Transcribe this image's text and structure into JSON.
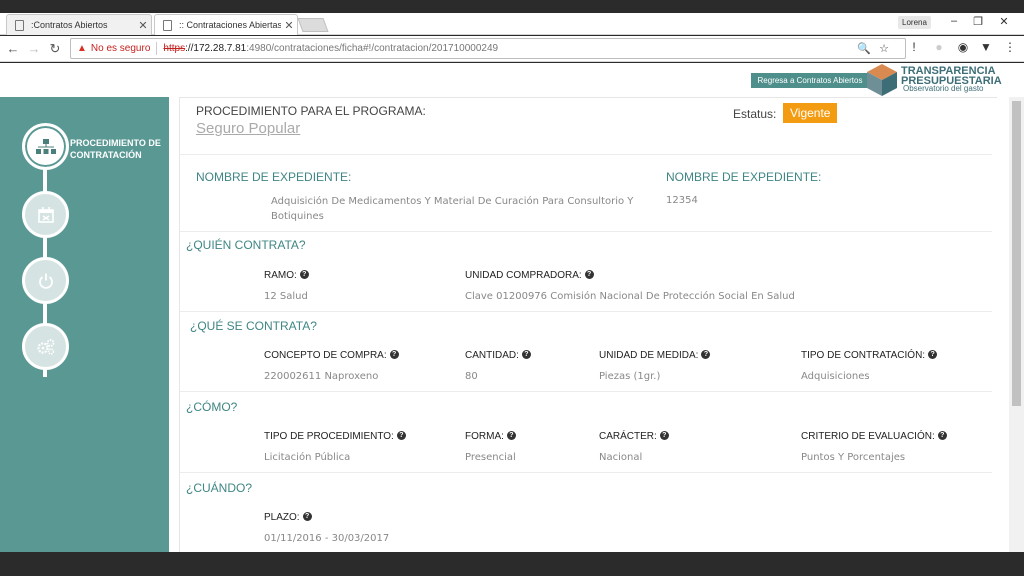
{
  "browser": {
    "tabs": [
      {
        "label": ":Contratos Abiertos"
      },
      {
        "label": ":: Contrataciones Abiertas"
      }
    ],
    "user": "Lorena",
    "insecure_label": "No es seguro",
    "url_scheme": "https",
    "url_host": "://172.28.7.81",
    "url_path": ":4980/contrataciones/ficha#!/contratacion/201710000249"
  },
  "header": {
    "back_link": "Regresa a Contratos Abiertos",
    "logo_line1": "TRANSPARENCIA",
    "logo_line2": "PRESUPUESTARIA",
    "logo_sub": "Observatorio del gasto"
  },
  "sidebar": {
    "active_step_label": "PROCEDIMIENTO DE CONTRATACIÓN"
  },
  "program": {
    "label": "PROCEDIMIENTO PARA EL PROGRAMA:",
    "name": "Seguro Popular",
    "status_label": "Estatus:",
    "status_value": "Vigente"
  },
  "expediente": {
    "name_label": "NOMBRE DE EXPEDIENTE:",
    "name_value": "Adquisición De Medicamentos Y Material De Curación Para Consultorio Y Botiquines",
    "number_label": "NOMBRE DE EXPEDIENTE:",
    "number_value": "12354"
  },
  "quien": {
    "title": "¿QUIÉN CONTRATA?",
    "ramo_label": "RAMO:",
    "ramo_value": "12 Salud",
    "unidad_label": "UNIDAD COMPRADORA:",
    "unidad_value": "Clave 01200976 Comisión Nacional De Protección Social En Salud"
  },
  "que": {
    "title": "¿QUÉ SE CONTRATA?",
    "concepto_label": "CONCEPTO DE COMPRA:",
    "concepto_value": "220002611 Naproxeno",
    "cantidad_label": "CANTIDAD:",
    "cantidad_value": "80",
    "unidad_label": "UNIDAD DE MEDIDA:",
    "unidad_value": "Piezas (1gr.)",
    "tipo_label": "TIPO DE CONTRATACIÓN:",
    "tipo_value": "Adquisiciones"
  },
  "como": {
    "title": "¿CÓMO?",
    "tipo_label": "TIPO DE PROCEDIMIENTO:",
    "tipo_value": "Licitación Pública",
    "forma_label": "FORMA:",
    "forma_value": "Presencial",
    "caracter_label": "CARÁCTER:",
    "caracter_value": "Nacional",
    "criterio_label": "CRITERIO DE EVALUACIÓN:",
    "criterio_value": "Puntos Y Porcentajes"
  },
  "cuando": {
    "title": "¿CUÁNDO?",
    "plazo_label": "PLAZO:",
    "plazo_value": "01/11/2016 - 30/03/2017"
  },
  "colors": {
    "teal": "#5a9894",
    "accent_text": "#3f8684",
    "status_badge": "#f39c12"
  }
}
